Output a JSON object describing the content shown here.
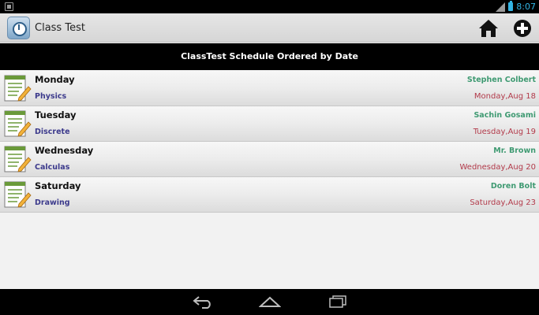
{
  "status_bar": {
    "time": "8:07",
    "network": "3G",
    "accent_color": "#33b5e5"
  },
  "action_bar": {
    "title": "Class Test",
    "home_icon": "home-icon",
    "add_icon": "add-circle-icon"
  },
  "header": {
    "title": "ClassTest Schedule Ordered by Date"
  },
  "schedule": [
    {
      "day": "Monday",
      "subject": "Physics",
      "teacher": "Stephen Colbert",
      "date": "Monday,Aug 18"
    },
    {
      "day": "Tuesday",
      "subject": "Discrete",
      "teacher": "Sachin Gosami",
      "date": "Tuesday,Aug 19"
    },
    {
      "day": "Wednesday",
      "subject": "Calculas",
      "teacher": "Mr. Brown",
      "date": "Wednesday,Aug 20"
    },
    {
      "day": "Saturday",
      "subject": "Drawing",
      "teacher": "Doren Bolt",
      "date": "Saturday,Aug 23"
    }
  ],
  "colors": {
    "subject": "#3c3a8c",
    "teacher": "#3f9a72",
    "date": "#b23a4a"
  },
  "nav_bar": {
    "back_icon": "back-icon",
    "home_icon": "nav-home-icon",
    "recent_icon": "recent-apps-icon"
  }
}
